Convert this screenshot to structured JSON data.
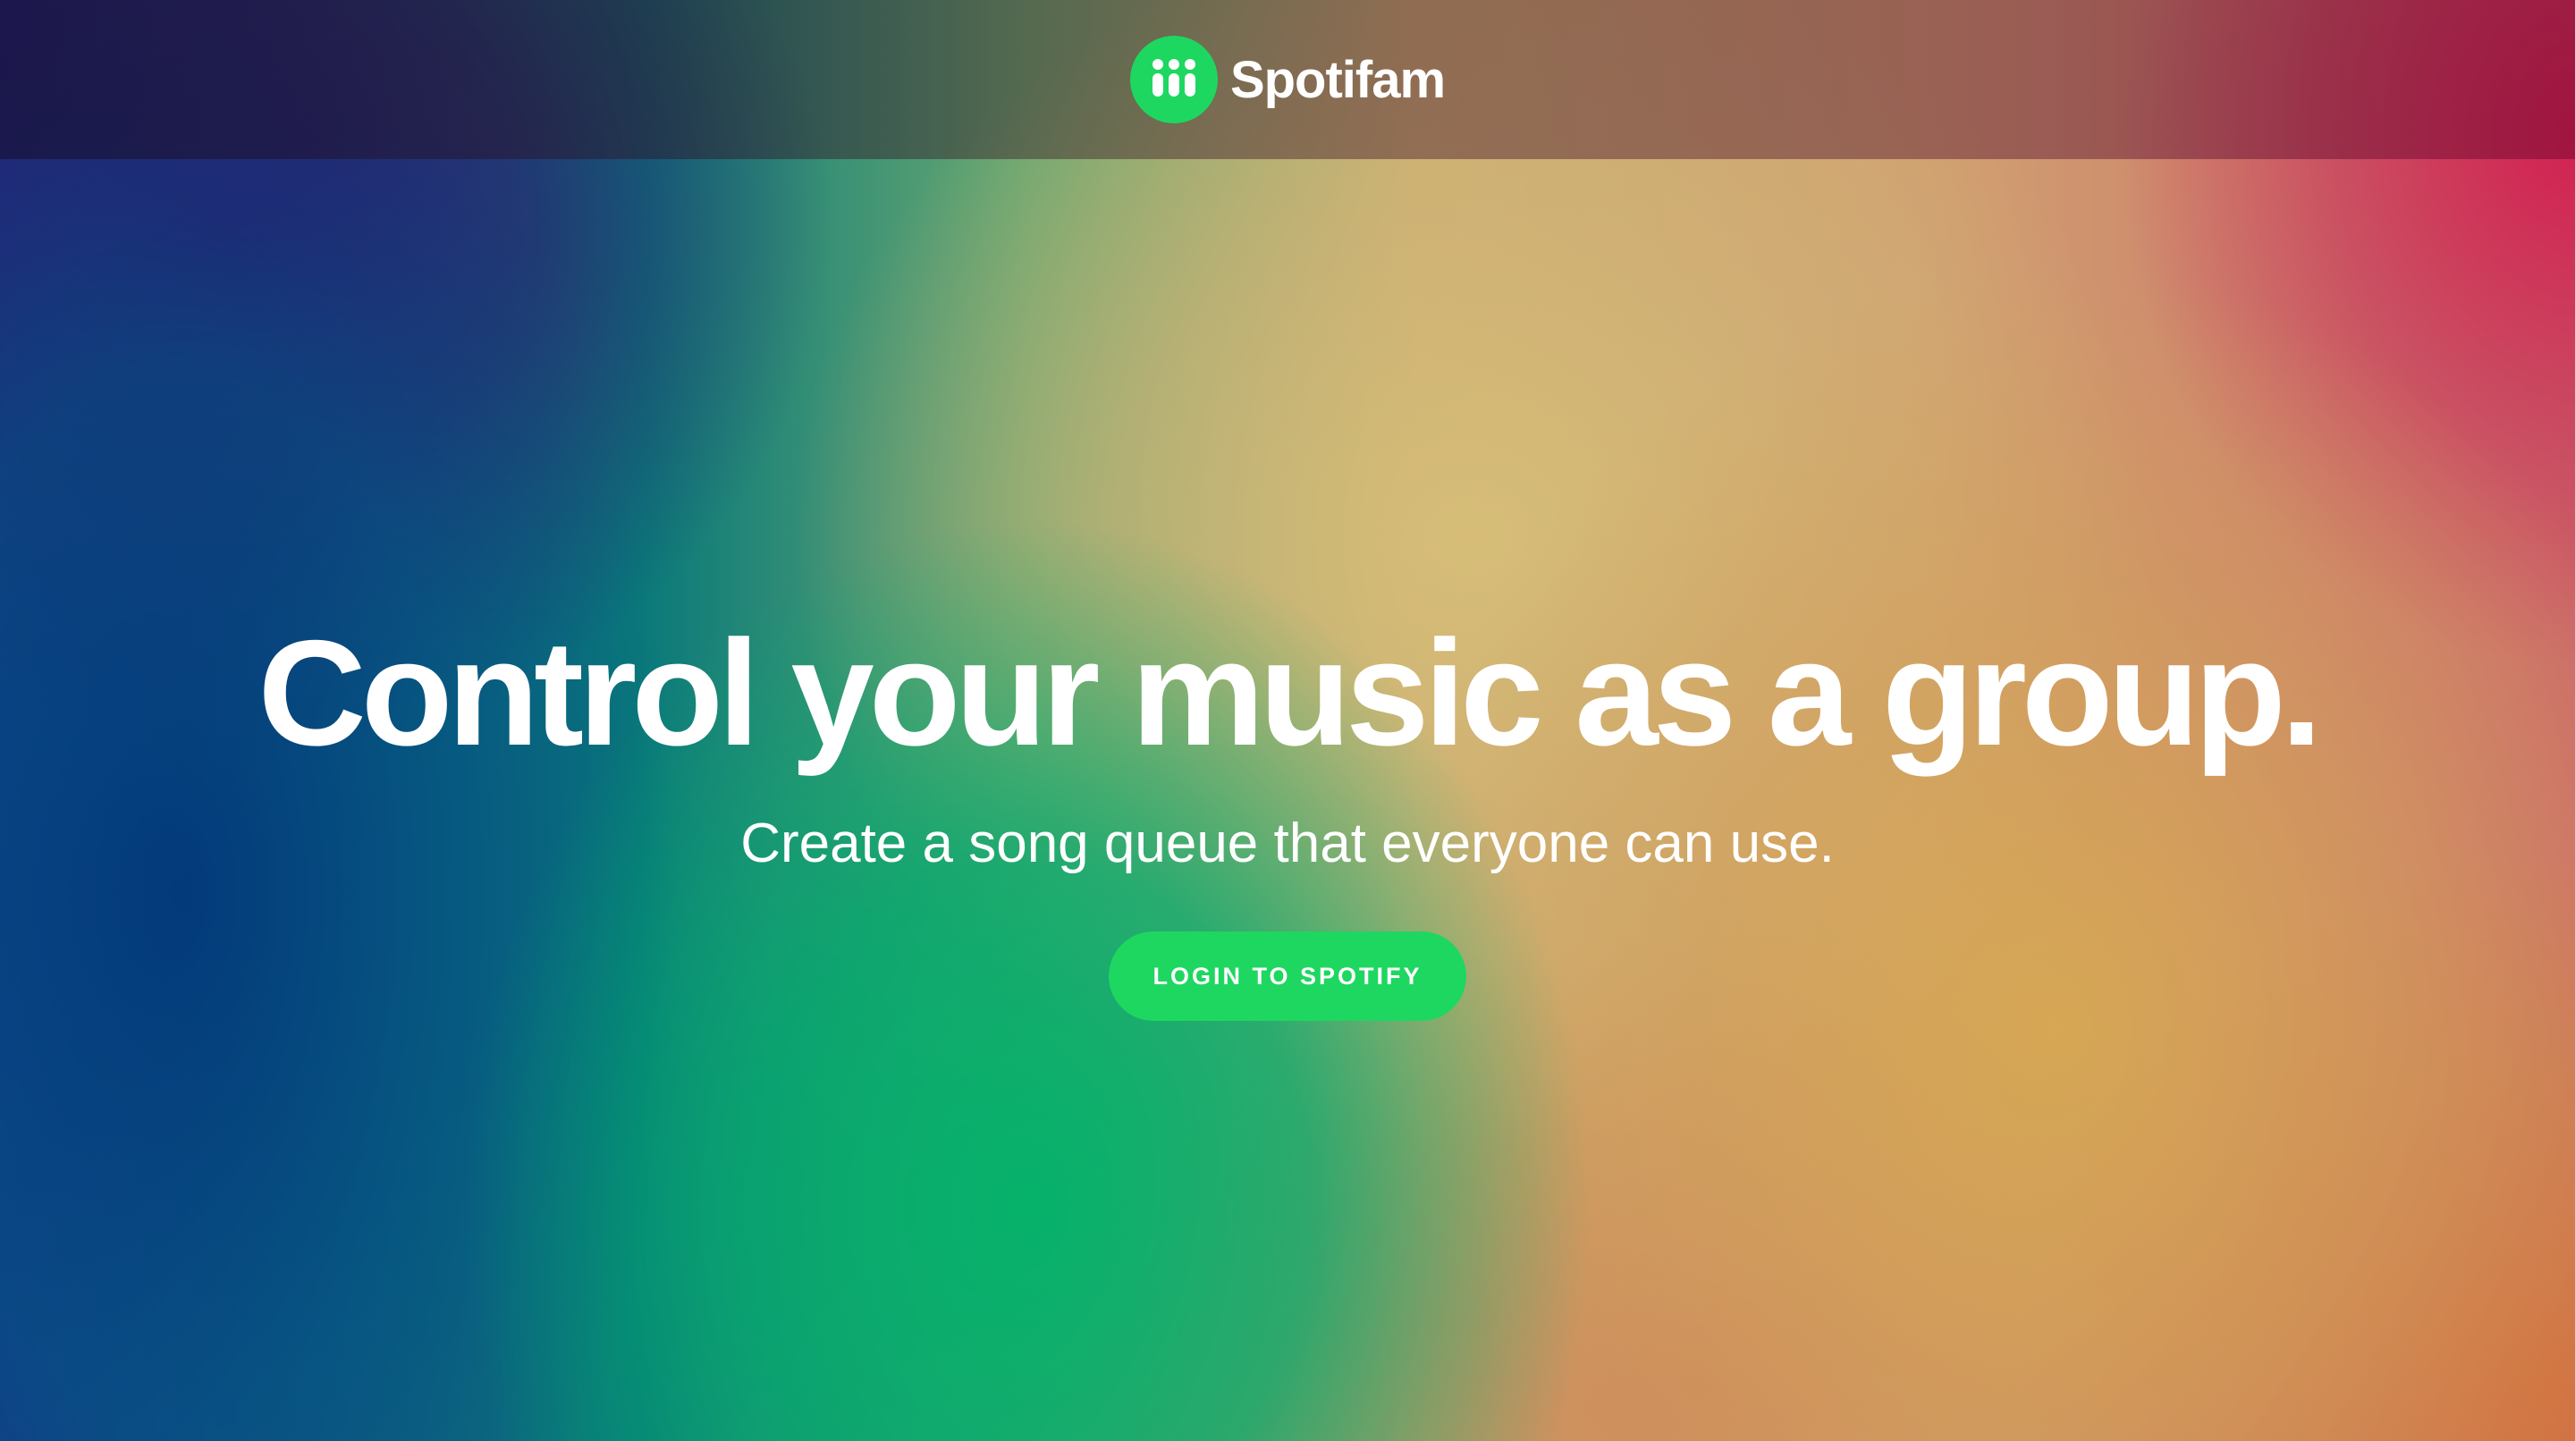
{
  "header": {
    "brand_name": "Spotifam",
    "logo_icon": "three-people-icon",
    "logo_color": "#1ed760"
  },
  "hero": {
    "headline": "Control your music as a group.",
    "subheadline": "Create a song queue that everyone can use.",
    "cta_label": "LOGIN TO SPOTIFY",
    "cta_color": "#1ed760"
  }
}
